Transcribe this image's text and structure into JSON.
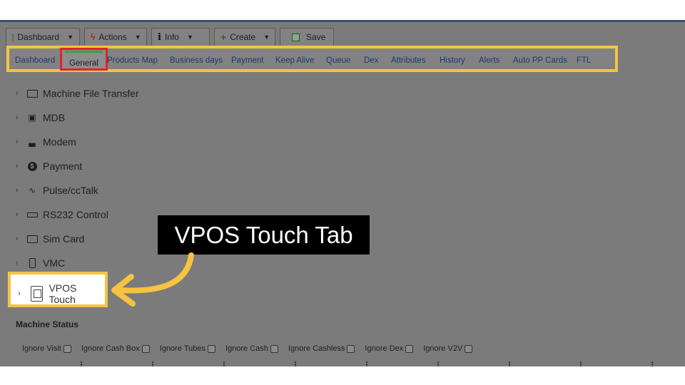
{
  "toolbar": {
    "dashboard_label": "Dashboard",
    "actions_label": "Actions",
    "info_label": "Info",
    "create_label": "Create",
    "save_label": "Save"
  },
  "tabs": [
    {
      "label": "Dashboard"
    },
    {
      "label": "General"
    },
    {
      "label": "Products Map"
    },
    {
      "label": "Business days"
    },
    {
      "label": "Payment"
    },
    {
      "label": "Keep Alive"
    },
    {
      "label": "Queue"
    },
    {
      "label": "Dex"
    },
    {
      "label": "Attributes"
    },
    {
      "label": "History"
    },
    {
      "label": "Alerts"
    },
    {
      "label": "Auto PP Cards"
    },
    {
      "label": "FTL"
    }
  ],
  "tree": [
    {
      "label": "Machine File Transfer",
      "icon": "file-transfer-icon"
    },
    {
      "label": "MDB",
      "icon": "mdb-icon"
    },
    {
      "label": "Modem",
      "icon": "modem-icon"
    },
    {
      "label": "Payment",
      "icon": "payment-icon"
    },
    {
      "label": "Pulse/ccTalk",
      "icon": "pulse-icon"
    },
    {
      "label": "RS232 Control",
      "icon": "rs232-icon"
    },
    {
      "label": "Sim Card",
      "icon": "sim-card-icon"
    },
    {
      "label": "VMC",
      "icon": "vmc-icon"
    },
    {
      "label": "VPOS Touch",
      "icon": "vpos-touch-icon"
    }
  ],
  "callout": {
    "text": "VPOS Touch Tab"
  },
  "machine_status": {
    "title": "Machine Status",
    "checkboxes": [
      {
        "label": "Ignore Visit"
      },
      {
        "label": "Ignore Cash Box"
      },
      {
        "label": "Ignore Tubes"
      },
      {
        "label": "Ignore Cash"
      },
      {
        "label": "Ignore Cashless"
      },
      {
        "label": "Ignore Dex"
      },
      {
        "label": "Ignore V2V"
      }
    ]
  },
  "colors": {
    "highlight_yellow": "#f6c343",
    "highlight_red": "#e5212b",
    "active_tab_green": "#3aa043",
    "tab_link": "#1d3a6a"
  }
}
